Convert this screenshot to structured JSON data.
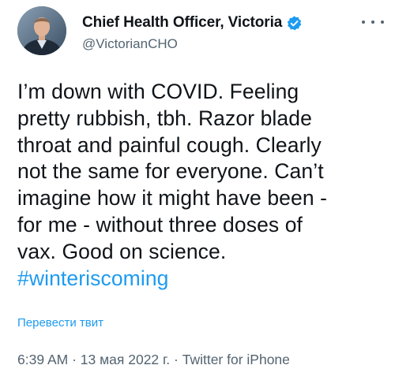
{
  "author": {
    "display_name": "Chief Health Officer, Victoria",
    "handle": "@VictorianCHO",
    "verified_icon": "verified-badge-icon",
    "avatar_icon": "profile-photo"
  },
  "tweet": {
    "lines": [
      "I’m down with COVID. Feeling",
      "pretty rubbish, tbh. Razor blade",
      "throat and painful cough. Clearly",
      "not the same for everyone. Can’t",
      "imagine how it might have been -",
      "for me - without three doses of",
      "vax. Good on science."
    ],
    "hashtag": "#winteriscoming"
  },
  "translate_label": "Перевести твит",
  "meta": {
    "time": "6:39 AM",
    "separator": "·",
    "date": "13 мая 2022 г.",
    "source": "Twitter for iPhone"
  },
  "colors": {
    "accent": "#1d9bf0",
    "secondary_text": "#536471",
    "primary_text": "#0f1419"
  },
  "more_icon": "more-horizontal-icon"
}
